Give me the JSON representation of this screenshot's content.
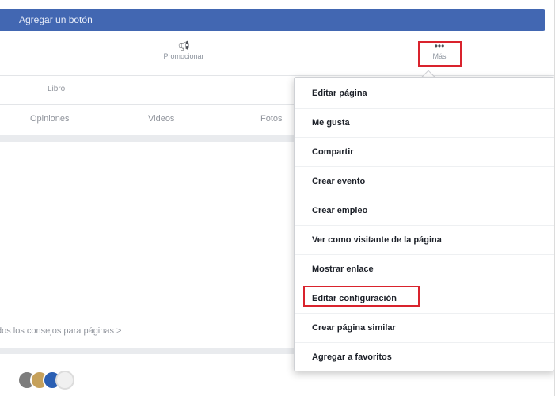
{
  "header": {
    "cta_label": "Agregar un botón",
    "brand_color": "#4267b2"
  },
  "actions": {
    "promote_label": "Promocionar",
    "promote_icon": "megaphone-icon",
    "more_label": "Más",
    "more_icon": "ellipsis-icon"
  },
  "about_row": {
    "label": "Libro"
  },
  "tabs": [
    "Opiniones",
    "Videos",
    "Fotos"
  ],
  "tips": {
    "link_text": "dos los consejos para páginas >"
  },
  "menu": {
    "items": [
      "Editar página",
      "Me gusta",
      "Compartir",
      "Crear evento",
      "Crear empleo",
      "Ver como visitante de la página",
      "Mostrar enlace",
      "Editar configuración",
      "Crear página similar",
      "Agregar a favoritos"
    ],
    "highlighted_item": "Editar configuración",
    "highlight_color": "#d9232d"
  }
}
